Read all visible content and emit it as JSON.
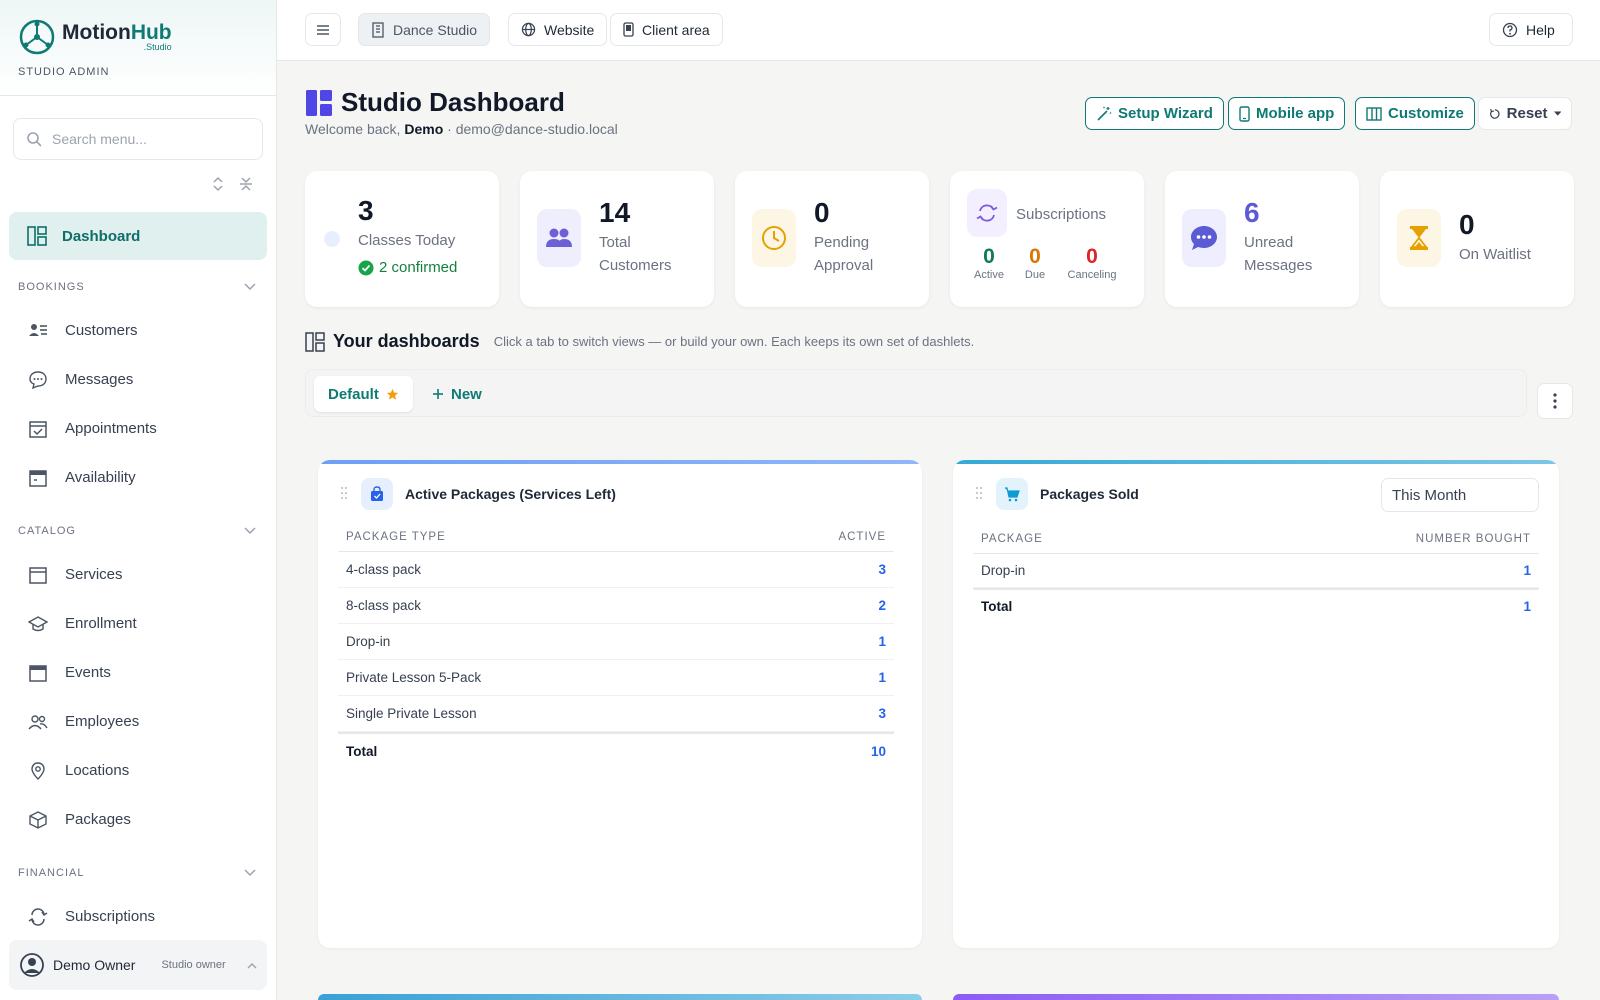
{
  "brand": {
    "name_part1": "Motion",
    "name_part2": "Hub",
    "sub": ".Studio",
    "role": "STUDIO ADMIN"
  },
  "sidebar": {
    "search_placeholder": "Search menu...",
    "active_item": "Dashboard",
    "sections": [
      {
        "label": "BOOKINGS",
        "items": [
          "Customers",
          "Messages",
          "Appointments",
          "Availability"
        ]
      },
      {
        "label": "CATALOG",
        "items": [
          "Services",
          "Enrollment",
          "Events",
          "Employees",
          "Locations",
          "Packages"
        ]
      },
      {
        "label": "FINANCIAL",
        "items": [
          "Subscriptions"
        ]
      }
    ],
    "user": {
      "name": "Demo Owner",
      "role": "Studio owner"
    }
  },
  "topbar": {
    "studio": "Dance Studio",
    "website": "Website",
    "client_area": "Client area",
    "help": "Help"
  },
  "page": {
    "title": "Studio Dashboard",
    "welcome_prefix": "Welcome back,",
    "welcome_name": "Demo",
    "welcome_email": "· demo@dance-studio.local",
    "actions": {
      "setup": "Setup Wizard",
      "mobile": "Mobile app",
      "customize": "Customize",
      "reset": "Reset"
    }
  },
  "stats": {
    "classes": {
      "value": "3",
      "label": "Classes Today",
      "confirmed": "2 confirmed"
    },
    "customers": {
      "value": "14",
      "label1": "Total",
      "label2": "Customers"
    },
    "pending": {
      "value": "0",
      "label1": "Pending",
      "label2": "Approval"
    },
    "subscriptions": {
      "label": "Subscriptions",
      "active": "0",
      "active_label": "Active",
      "due": "0",
      "due_label": "Due",
      "canceling": "0",
      "canceling_label": "Canceling"
    },
    "messages": {
      "value": "6",
      "label1": "Unread",
      "label2": "Messages"
    },
    "waitlist": {
      "value": "0",
      "label": "On Waitlist"
    }
  },
  "dashboards": {
    "title": "Your dashboards",
    "subtitle": "Click a tab to switch views — or build your own. Each keeps its own set of dashlets.",
    "tab_default": "Default",
    "tab_new": "New"
  },
  "packages_panel": {
    "title": "Active Packages (Services Left)",
    "col1": "PACKAGE TYPE",
    "col2": "ACTIVE",
    "rows": [
      {
        "name": "4-class pack",
        "value": "3"
      },
      {
        "name": "8-class pack",
        "value": "2"
      },
      {
        "name": "Drop-in",
        "value": "1"
      },
      {
        "name": "Private Lesson 5-Pack",
        "value": "1"
      },
      {
        "name": "Single Private Lesson",
        "value": "3"
      }
    ],
    "total_label": "Total",
    "total_value": "10"
  },
  "sold_panel": {
    "title": "Packages Sold",
    "period": "This Month",
    "col1": "PACKAGE",
    "col2": "NUMBER BOUGHT",
    "rows": [
      {
        "name": "Drop-in",
        "value": "1"
      }
    ],
    "total_label": "Total",
    "total_value": "1"
  },
  "colors": {
    "accent": "#0f7a74",
    "link": "#2563eb",
    "active_bg": "#dff0ef"
  }
}
